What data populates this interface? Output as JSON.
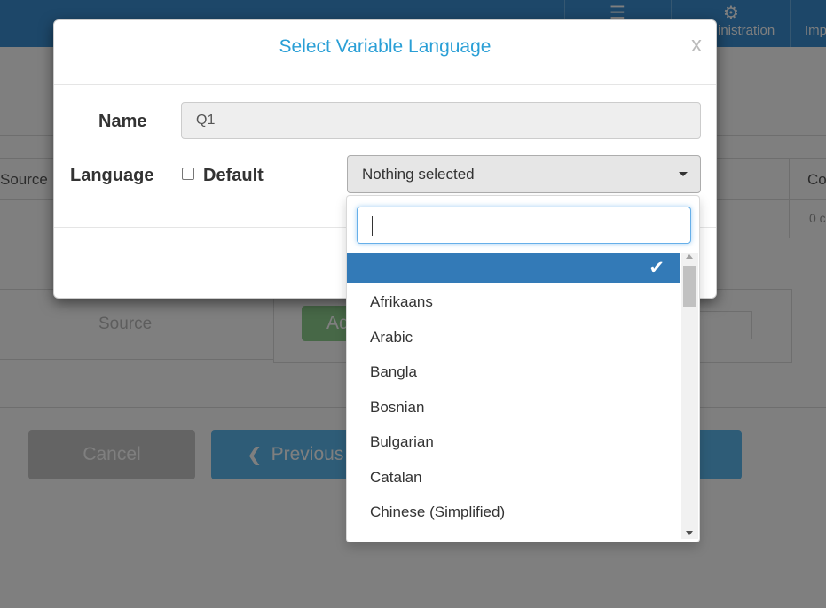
{
  "background": {
    "nav": [
      {
        "label": "",
        "icon": "list-icon"
      },
      {
        "label": "inistration",
        "icon": "gear-icon"
      },
      {
        "label": "Imp",
        "icon": ""
      }
    ],
    "table": {
      "header_left": "Source",
      "header_right": "Co",
      "cell_right": "0 c"
    },
    "source_panel_label": "Source",
    "add_button_label": "Ad",
    "cancel_button_label": "Cancel",
    "previous_button_label": "Previous"
  },
  "modal": {
    "title": "Select Variable Language",
    "close_label": "x",
    "name_label": "Name",
    "name_value": "Q1",
    "language_label": "Language",
    "default_checkbox_label": "Default",
    "default_checked": false,
    "select_value": "Nothing selected"
  },
  "dropdown": {
    "search_value": "",
    "items": [
      {
        "label": "",
        "selected": true
      },
      {
        "label": "Afrikaans",
        "selected": false
      },
      {
        "label": "Arabic",
        "selected": false
      },
      {
        "label": "Bangla",
        "selected": false
      },
      {
        "label": "Bosnian",
        "selected": false
      },
      {
        "label": "Bulgarian",
        "selected": false
      },
      {
        "label": "Catalan",
        "selected": false
      },
      {
        "label": "Chinese (Simplified)",
        "selected": false
      }
    ],
    "check_glyph": "✔"
  },
  "colors": {
    "accent": "#2a9fd6",
    "selected_bg": "#337ab7",
    "topbar": "#3a8fd3"
  }
}
